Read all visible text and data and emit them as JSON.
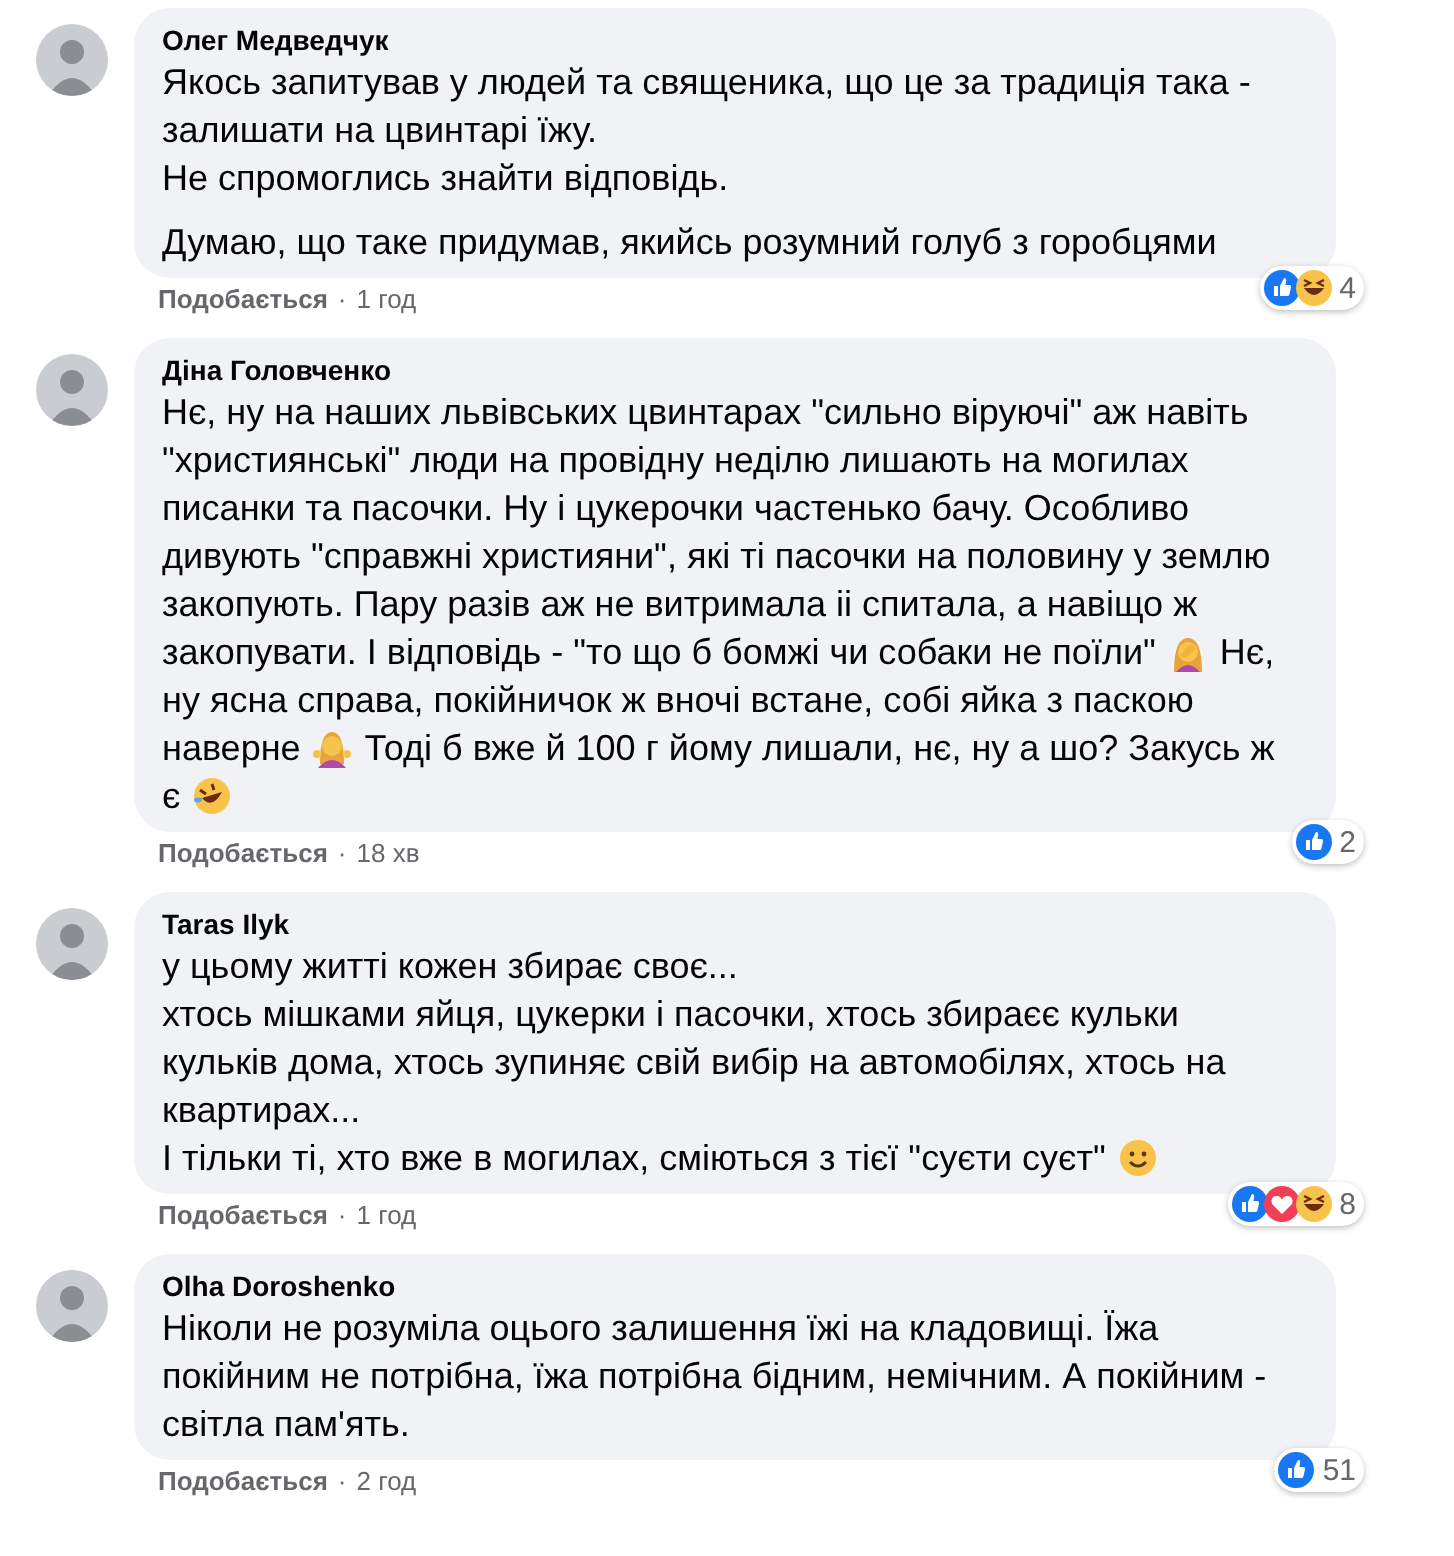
{
  "comments": [
    {
      "author": "Олег Медведчук",
      "paragraphs": [
        [
          [
            {
              "kind": "text",
              "text": "Якось запитував у людей та священика, що це за традиція така -"
            }
          ],
          [
            {
              "kind": "text",
              "text": "залишати на цвинтарі їжу."
            }
          ],
          [
            {
              "kind": "text",
              "text": "Не спромоглись знайти відповідь."
            }
          ]
        ],
        [
          [
            {
              "kind": "text",
              "text": "Думаю, що таке придумав, якийсь розумний голуб з горобцями"
            }
          ]
        ]
      ],
      "like_label": "Подобається",
      "separator": "·",
      "time": "1 год",
      "reactions": [
        {
          "kind": "like"
        },
        {
          "kind": "haha"
        }
      ],
      "reaction_count": "4"
    },
    {
      "author": "Діна Головченко",
      "paragraphs": [
        [
          [
            {
              "kind": "text",
              "text": "Нє, ну на наших львівських цвинтарах \"сильно віруючі\" аж навіть"
            }
          ],
          [
            {
              "kind": "text",
              "text": "\"християнські\" люди на провідну неділю лишають на могилах"
            }
          ],
          [
            {
              "kind": "text",
              "text": "писанки та пасочки. Ну і цукерочки частенько бачу. Особливо"
            }
          ],
          [
            {
              "kind": "text",
              "text": "дивують \"справжні християни\", які ті пасочки на половину у землю"
            }
          ],
          [
            {
              "kind": "text",
              "text": "закопують. Пару разів аж не витримала іі спитала, а навіщо ж"
            }
          ],
          [
            {
              "kind": "text",
              "text": "закопувати. І відповідь - \"то що б бомжі чи собаки не поїли\""
            },
            {
              "kind": "facepalm"
            },
            {
              "kind": "text",
              "text": "Нє,"
            }
          ],
          [
            {
              "kind": "text",
              "text": "ну ясна справа, покійничок ж вночі встане, собі яйка з паскою"
            }
          ],
          [
            {
              "kind": "text",
              "text": "наверне"
            },
            {
              "kind": "shrug"
            },
            {
              "kind": "text",
              "text": "Тоді б вже й 100 г йому лишали, нє, ну а шо? Закусь ж"
            }
          ],
          [
            {
              "kind": "text",
              "text": "є"
            },
            {
              "kind": "rofl"
            }
          ]
        ]
      ],
      "like_label": "Подобається",
      "separator": "·",
      "time": "18 хв",
      "reactions": [
        {
          "kind": "like"
        }
      ],
      "reaction_count": "2"
    },
    {
      "author": "Taras Ilyk",
      "paragraphs": [
        [
          [
            {
              "kind": "text",
              "text": "у цьому житті кожен збирає своє..."
            }
          ],
          [
            {
              "kind": "text",
              "text": "хтось мішками яйця, цукерки і пасочки, хтось збираєє кульки"
            }
          ],
          [
            {
              "kind": "text",
              "text": "кульків дома, хтось зупиняє свій вибір на автомобілях, хтось на"
            }
          ],
          [
            {
              "kind": "text",
              "text": "квартирах..."
            }
          ],
          [
            {
              "kind": "text",
              "text": "І тільки ті, хто вже в могилах, сміються з тієї \"суєти суєт\""
            },
            {
              "kind": "smile"
            }
          ]
        ]
      ],
      "like_label": "Подобається",
      "separator": "·",
      "time": "1 год",
      "reactions": [
        {
          "kind": "like"
        },
        {
          "kind": "love"
        },
        {
          "kind": "haha"
        }
      ],
      "reaction_count": "8"
    },
    {
      "author": "Olha Doroshenko",
      "paragraphs": [
        [
          [
            {
              "kind": "text",
              "text": "Ніколи не розуміла оцього залишення їжі на кладовищі. Їжа"
            }
          ],
          [
            {
              "kind": "text",
              "text": "покійним не потрібна, їжа потрібна бідним, немічним. А покійним -"
            }
          ],
          [
            {
              "kind": "text",
              "text": "світла пам'ять."
            }
          ]
        ]
      ],
      "like_label": "Подобається",
      "separator": "·",
      "time": "2 год",
      "reactions": [
        {
          "kind": "like"
        }
      ],
      "reaction_count": "51"
    }
  ]
}
